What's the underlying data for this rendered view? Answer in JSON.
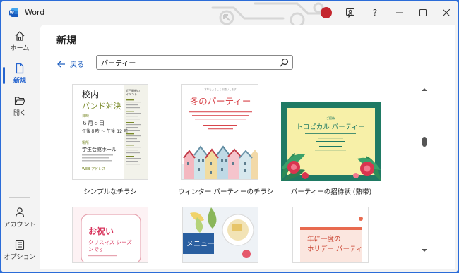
{
  "app": {
    "title": "Word"
  },
  "titlebar": {
    "help_label": "?"
  },
  "sidebar": {
    "items": [
      {
        "label": "ホーム"
      },
      {
        "label": "新規"
      },
      {
        "label": "開く"
      },
      {
        "label": "アカウント"
      },
      {
        "label": "オプション"
      }
    ]
  },
  "header": {
    "title": "新規",
    "back_label": "戻る"
  },
  "search": {
    "value": "パーティー"
  },
  "templates": [
    {
      "caption": "シンプルなチラシ",
      "thumb": {
        "title": "校内",
        "subtitle": "バンド対決",
        "date_label": "日時",
        "date": "６月８日",
        "time": "午後８時 ～ 午後 12 時",
        "place_label": "場所",
        "place": "学生会館ホール",
        "web": "WEB アドレス",
        "side_title": "近日開催の\nイベント"
      }
    },
    {
      "caption": "ウィンター パーティーのチラシ",
      "thumb": {
        "title": "冬のパーティー"
      }
    },
    {
      "caption": "パーティーの招待状 (熱帯)",
      "thumb": {
        "title": "トロピカル パーティー",
        "small_top": "ご招待"
      }
    },
    {
      "thumb": {
        "title": "お祝い",
        "sub": "クリスマス シーズンです"
      }
    },
    {
      "thumb": {
        "title": "メニュー"
      }
    },
    {
      "thumb": {
        "title": "年に一度の ホリデー パーティ"
      }
    }
  ],
  "colors": {
    "accent": "#2564cf",
    "word_blue": "#185abd",
    "winter_red": "#d8454b",
    "tropical_green": "#1f7a64",
    "tropical_yellow": "#f7f0a8",
    "olive": "#7a8a2a"
  }
}
